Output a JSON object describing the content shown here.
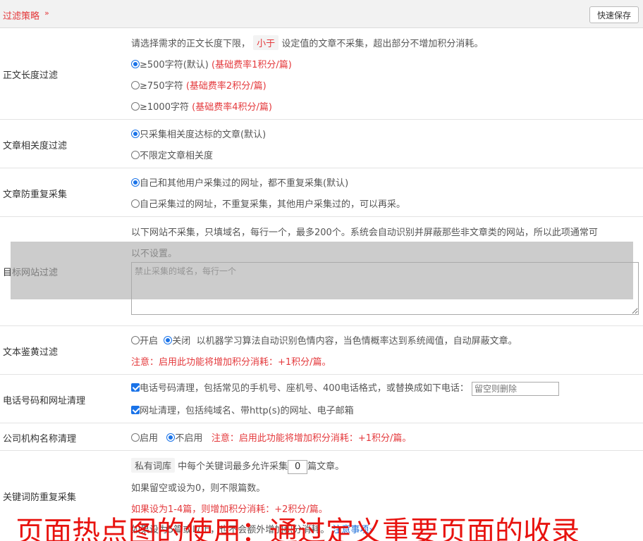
{
  "header": {
    "title": "过滤策略",
    "chevron": "»",
    "save_label": "快速保存"
  },
  "length_filter": {
    "label": "正文长度过滤",
    "desc_pre": "请选择需求的正文长度下限，",
    "desc_tag": "小于",
    "desc_post": "设定值的文章不采集，超出部分不增加积分消耗。",
    "options": [
      {
        "text": "≥500字符(默认)",
        "note": "(基础费率1积分/篇)",
        "checked": true
      },
      {
        "text": "≥750字符",
        "note": "(基础费率2积分/篇)",
        "checked": false
      },
      {
        "text": "≥1000字符",
        "note": "(基础费率4积分/篇)",
        "checked": false
      }
    ]
  },
  "relevance_filter": {
    "label": "文章相关度过滤",
    "options": [
      {
        "text": "只采集相关度达标的文章(默认)",
        "checked": true
      },
      {
        "text": "不限定文章相关度",
        "checked": false
      }
    ]
  },
  "dedupe": {
    "label": "文章防重复采集",
    "options": [
      {
        "text": "自己和其他用户采集过的网址，都不重复采集(默认)",
        "checked": true
      },
      {
        "text": "自己采集过的网址，不重复采集，其他用户采集过的，可以再采。",
        "checked": false
      }
    ]
  },
  "site_filter": {
    "label": "目标网站过滤",
    "desc_line1": "以下网站不采集，只填域名，每行一个，最多200个。系统会自动识别并屏蔽那些非文章类的网站，所以此项通常可",
    "desc_line2": "以不设置。",
    "placeholder": "禁止采集的域名，每行一个"
  },
  "porn_filter": {
    "label": "文本鉴黄过滤",
    "on_label": "开启",
    "off_label": "关闭",
    "desc": "以机器学习算法自动识别色情内容，当色情概率达到系统阈值，自动屏蔽文章。",
    "note": "注意：启用此功能将增加积分消耗：+1积分/篇。"
  },
  "phone_url": {
    "label": "电话号码和网址清理",
    "phone_text": "电话号码清理，包括常见的手机号、座机号、400电话格式，或替换成如下电话：",
    "phone_placeholder": "留空则删除",
    "url_text": "网址清理，包括纯域名、带http(s)的网址、电子邮箱"
  },
  "company": {
    "label": "公司机构名称清理",
    "on_label": "启用",
    "off_label": "不启用",
    "note": "注意：启用此功能将增加积分消耗：+1积分/篇。"
  },
  "keyword": {
    "label": "关键词防重复采集",
    "tag": "私有词库",
    "text_pre": "中每个关键词最多允许采集",
    "value": "0",
    "text_post": "篇文章。",
    "line2": "如果留空或设为0，则不限篇数。",
    "line3": "如果设为1-4篇，则增加积分消耗：+2积分/篇。",
    "line4_pre": "如果设为5篇或以上，也不会额外增加积分消耗。",
    "line4_link": "注意事项»"
  },
  "banner": "页面热点图的使用：通过定义重要页面的收录"
}
